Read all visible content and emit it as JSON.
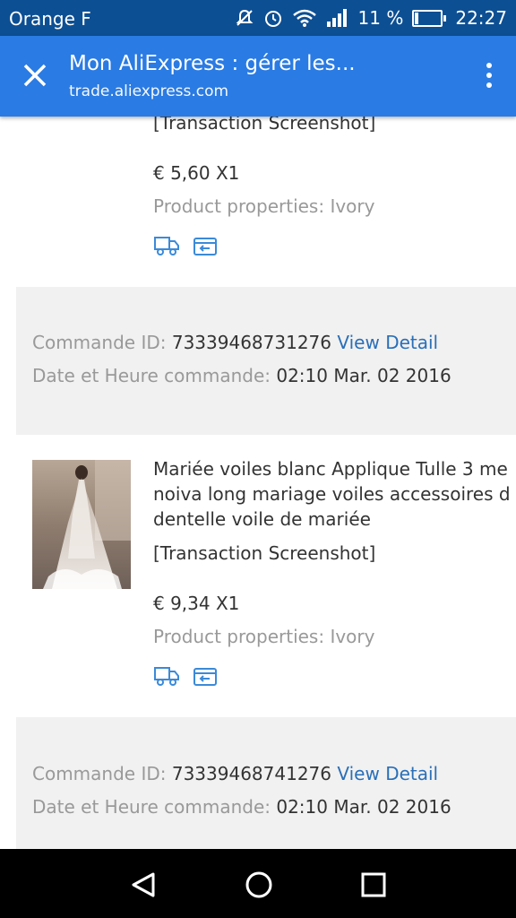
{
  "status_bar": {
    "carrier": "Orange F",
    "battery": "11 %",
    "battery_level": 0.11,
    "time": "22:27"
  },
  "app_bar": {
    "title": "Mon AliExpress : gérer les...",
    "url": "trade.aliexpress.com"
  },
  "items": [
    {
      "transaction_label": "[Transaction Screenshot]",
      "price": "€ 5,60 X1",
      "properties": "Product properties: Ivory"
    },
    {
      "title_lines": [
        "Mariée voiles blanc Applique Tulle 3 me",
        "noiva long mariage voiles accessoires d",
        "dentelle voile de mariée"
      ],
      "transaction_label": "[Transaction Screenshot]",
      "price": "€ 9,34 X1",
      "properties": "Product properties: Ivory"
    }
  ],
  "orders": [
    {
      "id_label": "Commande ID:",
      "id": "73339468731276",
      "detail_link": "View Detail",
      "date_label": "Date et Heure commande:",
      "date": "02:10 Mar. 02 2016"
    },
    {
      "id_label": "Commande ID:",
      "id": "73339468741276",
      "detail_link": "View Detail",
      "date_label": "Date et Heure commande:",
      "date": "02:10 Mar. 02 2016"
    }
  ],
  "colors": {
    "status_bar": "#0d4f93",
    "app_bar": "#2a7be3",
    "link": "#2a6fb8",
    "band": "#f1f1f1"
  }
}
